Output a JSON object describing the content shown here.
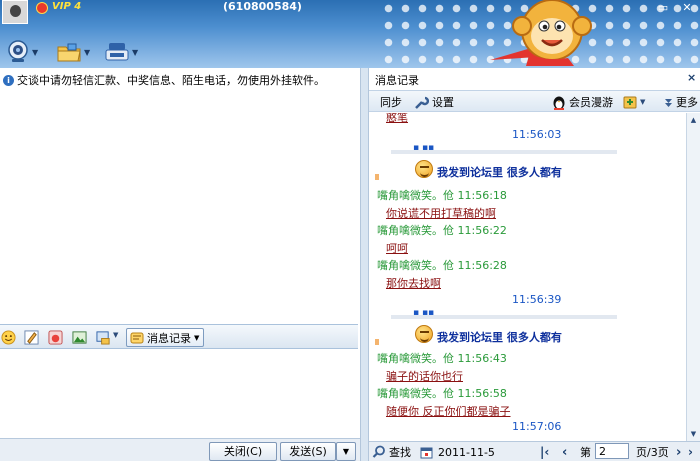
{
  "header": {
    "vip_label": "VIP 4",
    "window_title": "(610800584)"
  },
  "left": {
    "notice": "交谈中请勿轻信汇款、中奖信息、陌生电话，勿使用外挂软件。",
    "history_button_label": "消息记录",
    "close_button_label": "关闭(C)",
    "send_button_label": "发送(S)"
  },
  "history_panel": {
    "title": "消息记录",
    "close_symbol": "×",
    "sync_label": "同步",
    "settings_label": "设置",
    "member_label": "会员漫游",
    "more_label": "更多",
    "messages": [
      {
        "kind": "content",
        "text": "憨笔"
      },
      {
        "kind": "time",
        "text": "11:56:03"
      },
      {
        "kind": "picture",
        "text": "我发到论坛里  很多人都有"
      },
      {
        "kind": "sender",
        "text": "嘴角噙微笑。伧 11:56:18"
      },
      {
        "kind": "content",
        "text": "你说谎不用打草稿的啊"
      },
      {
        "kind": "sender",
        "text": "嘴角噙微笑。伧 11:56:22"
      },
      {
        "kind": "content",
        "text": "呵呵"
      },
      {
        "kind": "sender",
        "text": "嘴角噙微笑。伧 11:56:28"
      },
      {
        "kind": "content",
        "text": "那你去找啊"
      },
      {
        "kind": "time",
        "text": "11:56:39"
      },
      {
        "kind": "picture",
        "text": "我发到论坛里  很多人都有"
      },
      {
        "kind": "sender",
        "text": "嘴角噙微笑。伧 11:56:43"
      },
      {
        "kind": "content",
        "text": "骗子的话你也行"
      },
      {
        "kind": "sender",
        "text": "嘴角噙微笑。伧 11:56:58"
      },
      {
        "kind": "content",
        "text": "随便你    反正你们都是骗子"
      },
      {
        "kind": "time",
        "text": "11:57:06"
      }
    ],
    "find_label": "查找",
    "date_label": "2011-11-5",
    "page_prefix": "第",
    "page_value": "2",
    "page_suffix": "页/3页"
  }
}
